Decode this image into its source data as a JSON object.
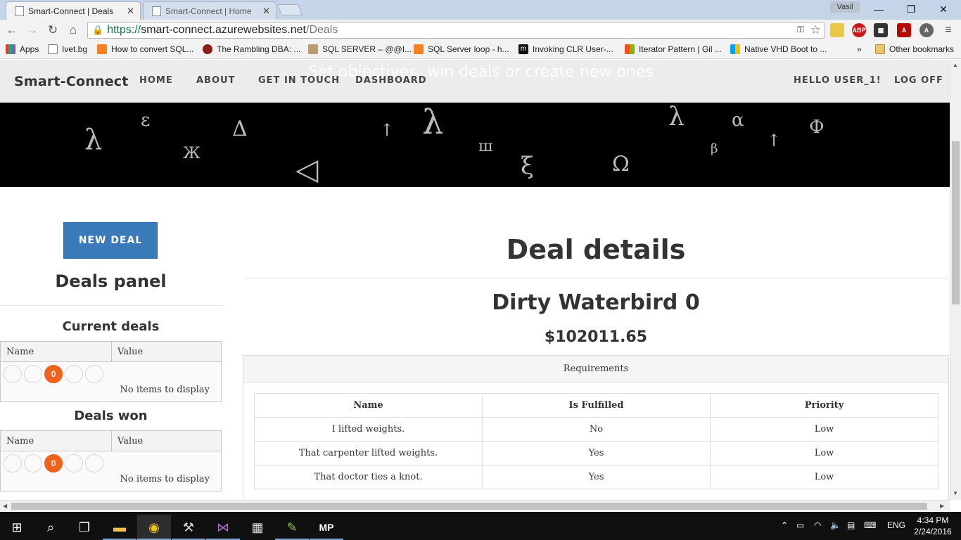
{
  "browser": {
    "tabs": [
      {
        "title": "Smart-Connect | Deals",
        "active": true
      },
      {
        "title": "Smart-Connect | Home",
        "active": false
      }
    ],
    "profile_name": "Vasil",
    "url": {
      "scheme": "https://",
      "host": "smart-connect.azurewebsites.net",
      "path": "/Deals"
    },
    "bookmarks": [
      "Apps",
      "Ivet.bg",
      "How to convert SQL...",
      "The Rambling DBA: ...",
      "SQL SERVER – @@I...",
      "SQL Server loop - h...",
      "Invoking CLR User-...",
      "Iterator Pattern | Gil ...",
      "Native VHD Boot to ..."
    ],
    "bookmarks_overflow": "»",
    "other_bookmarks": "Other bookmarks"
  },
  "site": {
    "brand": "Smart-Connect",
    "nav": [
      "HOME",
      "ABOUT",
      "GET IN TOUCH",
      "DASHBOARD"
    ],
    "greeting": "HELLO USER_1!",
    "logoff": "LOG OFF",
    "tagline": "Set objectives, win deals or create new ones"
  },
  "sidebar": {
    "new_deal_label": "NEW DEAL",
    "panel_title": "Deals panel",
    "current": {
      "title": "Current deals",
      "columns": [
        "Name",
        "Value"
      ],
      "pager": [
        "",
        "",
        "0",
        "",
        ""
      ],
      "empty_text": "No items to display"
    },
    "won": {
      "title": "Deals won",
      "columns": [
        "Name",
        "Value"
      ],
      "pager": [
        "",
        "",
        "0",
        "",
        ""
      ],
      "empty_text": "No items to display"
    }
  },
  "main": {
    "heading": "Deal details",
    "deal_name": "Dirty Waterbird 0",
    "deal_value": "$102011.65",
    "requirements": {
      "title": "Requirements",
      "columns": [
        "Name",
        "Is Fulfilled",
        "Priority"
      ],
      "rows": [
        [
          "I lifted weights.",
          "No",
          "Low"
        ],
        [
          "That carpenter lifted weights.",
          "Yes",
          "Low"
        ],
        [
          "That doctor ties a knot.",
          "Yes",
          "Low"
        ]
      ]
    }
  },
  "taskbar": {
    "language": "ENG",
    "time": "4:34 PM",
    "date": "2/24/2016"
  },
  "colors": {
    "accent_button": "#3a7ab8",
    "pager_active": "#f0621c",
    "omnibox_secure": "#0b8043",
    "taskbar_bg": "#101010"
  }
}
